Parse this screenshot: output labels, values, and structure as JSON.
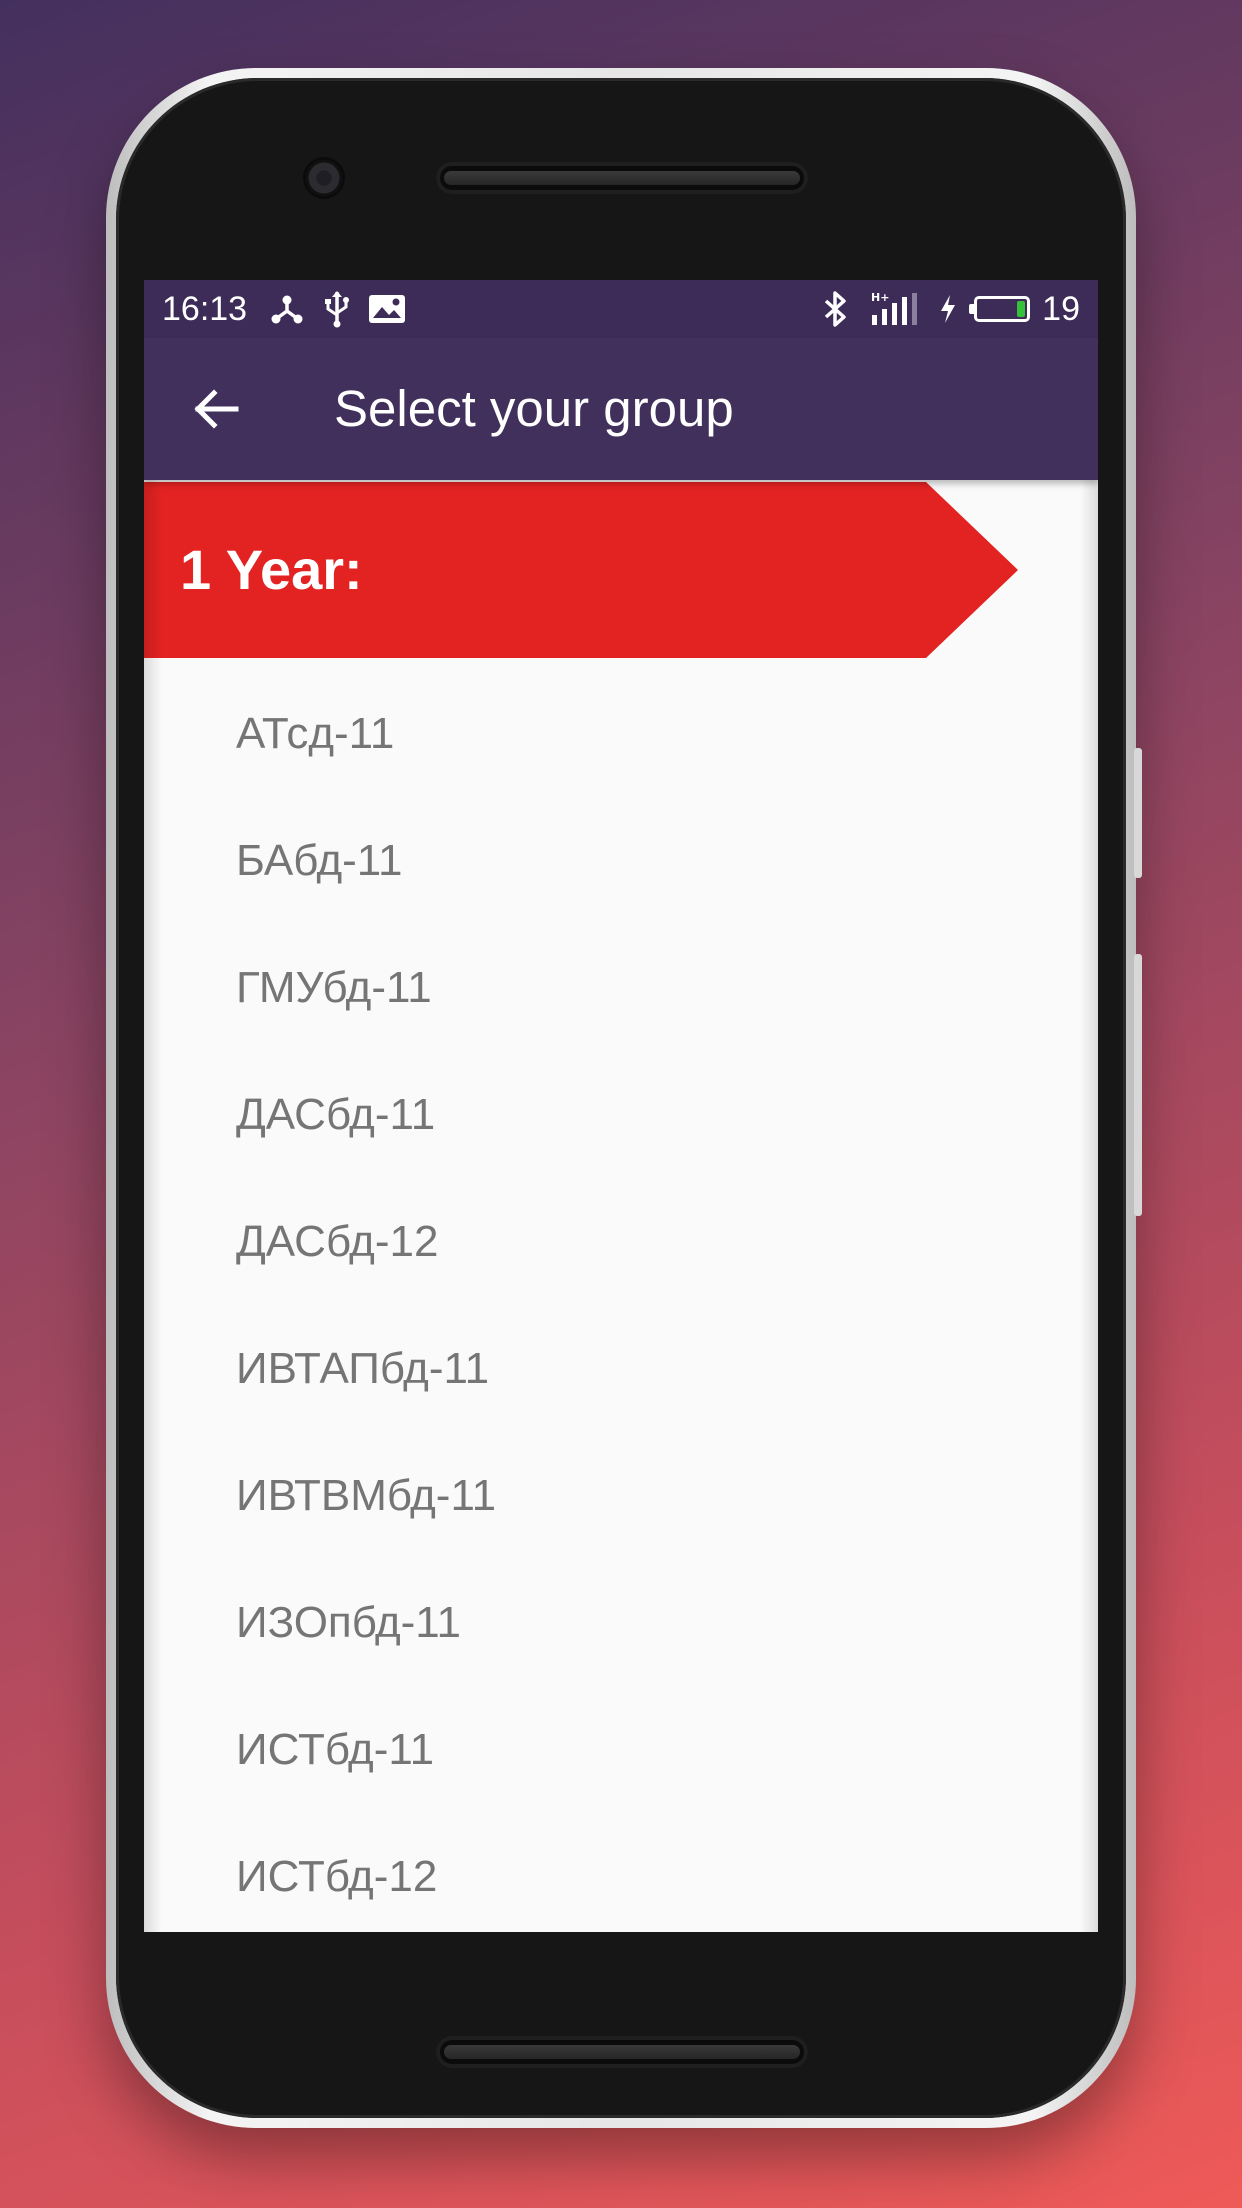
{
  "status_bar": {
    "time": "16:13",
    "left_icons": [
      "network-share-icon",
      "usb-icon",
      "image-notification-icon"
    ],
    "right_icons": [
      "bluetooth-icon",
      "signal-hplus-icon",
      "charging-icon",
      "battery-icon"
    ],
    "battery_percent": "19",
    "battery_level": 0.19,
    "battery_color": "#35c23a"
  },
  "app_bar": {
    "title": "Select your group",
    "back_icon": "arrow-back-icon",
    "background": "#42305c"
  },
  "section": {
    "label": "1 Year:",
    "color": "#e32222"
  },
  "groups": [
    "АТсд-11",
    "БАбд-11",
    "ГМУбд-11",
    "ДАСбд-11",
    "ДАСбд-12",
    "ИВТАПбд-11",
    "ИВТВМбд-11",
    "ИЗОпбд-11",
    "ИСТбд-11",
    "ИСТбд-12"
  ]
}
